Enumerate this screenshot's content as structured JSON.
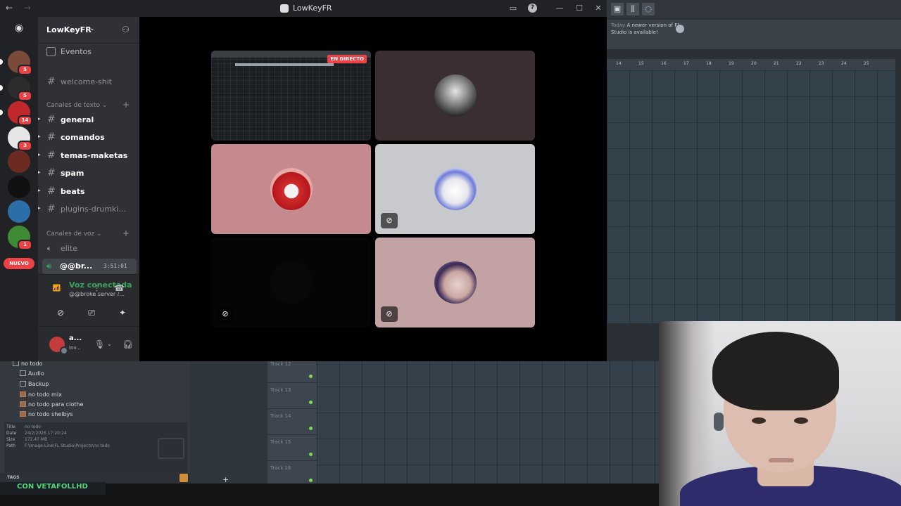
{
  "window": {
    "title": "LowKeyFR",
    "nav_back": "←",
    "nav_forward": "→",
    "inbox_icon": "inbox-icon",
    "help_label": "?",
    "min_label": "—",
    "max_label": "☐",
    "close_label": "✕"
  },
  "rail": {
    "home_icon": "discord-logo-icon",
    "servers": [
      {
        "name": "server-1",
        "badge": "5",
        "color": "#7a4a3a"
      },
      {
        "name": "server-2",
        "badge": "5",
        "color": "#2c2c2c"
      },
      {
        "name": "server-3",
        "badge": "14",
        "color": "#c0282b"
      },
      {
        "name": "server-4",
        "badge": "3",
        "color": "#e6e6e6"
      },
      {
        "name": "server-5",
        "badge": "",
        "color": "#6b2b23"
      },
      {
        "name": "server-6",
        "badge": "",
        "color": "#111111"
      },
      {
        "name": "server-7",
        "badge": "",
        "color": "#2b6ea8"
      },
      {
        "name": "server-8",
        "badge": "1",
        "color": "#3f8a35"
      }
    ],
    "new_label": "NUEVO"
  },
  "sidebar": {
    "server_name": "LowKeyFR",
    "chevron": "⌄",
    "events_label": "Eventos",
    "welcome_channel": "welcome-shit",
    "text_category": "Canales de texto",
    "text_channels": [
      {
        "name": "general",
        "unread": true
      },
      {
        "name": "comandos",
        "unread": true
      },
      {
        "name": "temas-maketas",
        "unread": true
      },
      {
        "name": "spam",
        "unread": true
      },
      {
        "name": "beats",
        "unread": true
      },
      {
        "name": "plugins-drumki...",
        "unread": false
      }
    ],
    "voice_category": "Canales de voz",
    "voice_channels": [
      {
        "name": "elite"
      }
    ],
    "active_voice": {
      "name": "@@br...",
      "time": "3:51:01"
    },
    "hash": "#",
    "plus": "+"
  },
  "voice_panel": {
    "status": "Voz conectada",
    "subtitle": "@@broke server /...",
    "buttons": [
      "camera-off-icon",
      "screen-share-icon",
      "activities-icon",
      "soundboard-icon"
    ]
  },
  "user_panel": {
    "name": "a...",
    "status": "Inv..."
  },
  "video": {
    "live_label": "EN DIRECTO",
    "tiles": [
      {
        "id": "screen-share",
        "bg": "#111111"
      },
      {
        "id": "participant-2",
        "bg": "#3a2e30"
      },
      {
        "id": "participant-3",
        "bg": "#c48a8e"
      },
      {
        "id": "participant-4",
        "bg": "#c8c9cd"
      },
      {
        "id": "participant-5",
        "bg": "#050505"
      },
      {
        "id": "participant-6",
        "bg": "#c3a2a4"
      }
    ]
  },
  "fl_studio": {
    "notice_prefix": "Today",
    "notice_text": "A newer version of FL Studio is available!",
    "ruler": [
      "14",
      "15",
      "16",
      "17",
      "18",
      "19",
      "20",
      "21",
      "22",
      "23",
      "24",
      "25"
    ],
    "tracks": [
      "Track 12",
      "Track 13",
      "Track 14",
      "Track 15",
      "Track 16"
    ],
    "browser": {
      "root": "no todo",
      "folders": [
        "Audio",
        "Backup"
      ],
      "files": [
        "no todo mix",
        "no todo para clothe",
        "no todo shelbys"
      ],
      "meta": [
        {
          "key": "Title",
          "value": "no todo"
        },
        {
          "key": "Date",
          "value": "24/2/2026 17:20:24"
        },
        {
          "key": "Size",
          "value": "172.47 MB"
        },
        {
          "key": "Path",
          "value": "F:\\Image-Line\\FL Studio\\Projects\\no todo"
        }
      ],
      "tags_label": "TAGS"
    },
    "overlay_text": "CON VETAFOLLHD"
  }
}
